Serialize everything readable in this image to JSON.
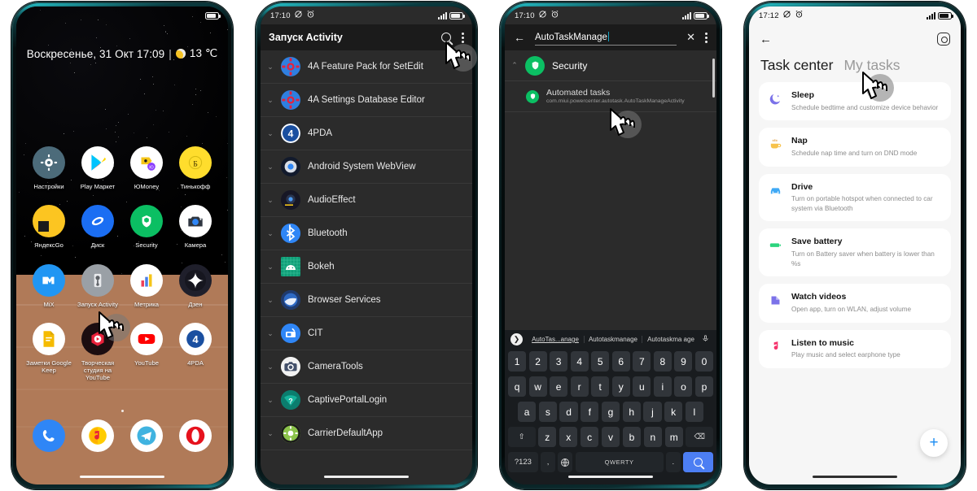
{
  "phones": [
    {
      "id": "home-screen",
      "statusbar": {
        "time": "",
        "icons": [
          "dnd-off-icon",
          "alarm-icon"
        ],
        "signal": "signal-icon",
        "battery": "battery-icon"
      },
      "widget": {
        "text": "Воскресенье, 31 Окт  17:09",
        "separator": "|",
        "weather_icon": "partly-sunny-icon",
        "temperature": "13 ℃"
      },
      "apps": [
        {
          "label": "Настройки",
          "icon": "gear-icon",
          "bg": "#4c6b7a",
          "glyph": "⚙"
        },
        {
          "label": "Play Маркет",
          "icon": "play-store-icon",
          "bg": "#ffffff",
          "glyph": "▶"
        },
        {
          "label": "ЮMoney",
          "icon": "yoomoney-icon",
          "bg": "#ffffff",
          "glyph": "💳"
        },
        {
          "label": "Тинькофф",
          "icon": "tinkoff-icon",
          "bg": "#ffdd2d",
          "glyph": "Т"
        },
        {
          "label": "ЯндексGo",
          "icon": "yandex-go-icon",
          "bg": "#fcc521",
          "glyph": ""
        },
        {
          "label": "Диск",
          "icon": "yandex-disk-icon",
          "bg": "#1b6ef3",
          "glyph": ""
        },
        {
          "label": "Security",
          "icon": "security-shield-icon",
          "bg": "#0bbf63",
          "glyph": "⬢"
        },
        {
          "label": "Камера",
          "icon": "camera-icon",
          "bg": "#ffffff",
          "glyph": "◉"
        },
        {
          "label": "MiX",
          "icon": "mixplorer-icon",
          "bg": "#2196f3",
          "glyph": ""
        },
        {
          "label": "Запуск Activity",
          "icon": "activity-launcher-icon",
          "bg": "#9aa0a6",
          "glyph": ""
        },
        {
          "label": "Метрика",
          "icon": "yandex-metrica-icon",
          "bg": "#ffffff",
          "glyph": ""
        },
        {
          "label": "Дзен",
          "icon": "zen-icon",
          "bg": "#1f1f2b",
          "glyph": "✦"
        },
        {
          "label": "Заметки Google Keep",
          "icon": "google-keep-icon",
          "bg": "#ffffff",
          "glyph": ""
        },
        {
          "label": "Творческая студия на YouTube",
          "icon": "youtube-studio-icon",
          "bg": "#1c0d10",
          "glyph": ""
        },
        {
          "label": "YouTube",
          "icon": "youtube-icon",
          "bg": "#ffffff",
          "glyph": ""
        },
        {
          "label": "4PDA",
          "icon": "4pda-icon",
          "bg": "#ffffff",
          "glyph": "4"
        }
      ],
      "dock": [
        {
          "label": "phone",
          "icon": "phone-icon",
          "bg": "#2f86f6",
          "glyph": "📞"
        },
        {
          "label": "yandex-music",
          "icon": "yandex-music-icon",
          "bg": "#ffffff",
          "glyph": ""
        },
        {
          "label": "telegram",
          "icon": "telegram-icon",
          "bg": "#ffffff",
          "glyph": ""
        },
        {
          "label": "opera",
          "icon": "opera-icon",
          "bg": "#ffffff",
          "glyph": ""
        }
      ],
      "page_indicator": "•"
    },
    {
      "id": "activity-launcher",
      "statusbar": {
        "time": "17:10",
        "icons": [
          "dnd-off-icon",
          "alarm-icon"
        ]
      },
      "appbar": {
        "title": "Запуск Activity",
        "search_icon": "search-icon",
        "overflow_icon": "more-vertical-icon"
      },
      "items": [
        {
          "name": "4A Feature Pack for SetEdit",
          "icon": "gear-red-blue-icon",
          "bg": "#2f7fe0",
          "glyph": "✹"
        },
        {
          "name": "4A Settings Database Editor",
          "icon": "gear-red-blue-icon",
          "bg": "#2f7fe0",
          "glyph": "✹"
        },
        {
          "name": "4PDA",
          "icon": "4pda-icon",
          "bg": "#1a4fa0",
          "glyph": "4"
        },
        {
          "name": "Android System WebView",
          "icon": "webview-icon",
          "bg": "#1a2438",
          "glyph": "◎"
        },
        {
          "name": "AudioEffect",
          "icon": "audioeffect-icon",
          "bg": "#1b1b28",
          "glyph": "◉"
        },
        {
          "name": "Bluetooth",
          "icon": "bluetooth-icon",
          "bg": "#2f86f6",
          "glyph": "✦"
        },
        {
          "name": "Bokeh",
          "icon": "bokeh-android-icon",
          "bg": "#0f9d77",
          "glyph": "⌬"
        },
        {
          "name": "Browser Services",
          "icon": "browser-services-icon",
          "bg": "#2a4a8f",
          "glyph": "◑"
        },
        {
          "name": "CIT",
          "icon": "cit-icon",
          "bg": "#2f86f6",
          "glyph": "▣"
        },
        {
          "name": "CameraTools",
          "icon": "camera-tools-icon",
          "bg": "#f2f2f2",
          "glyph": "◉"
        },
        {
          "name": "CaptivePortalLogin",
          "icon": "captive-portal-icon",
          "bg": "#14897a",
          "glyph": "?"
        },
        {
          "name": "CarrierDefaultApp",
          "icon": "carrier-default-icon",
          "bg": "#8bc34a",
          "glyph": "⚙"
        }
      ]
    },
    {
      "id": "activity-search",
      "statusbar": {
        "time": "17:10",
        "icons": [
          "dnd-off-icon",
          "alarm-icon"
        ]
      },
      "appbar": {
        "back_icon": "back-arrow-icon",
        "query": "AutoTaskManage",
        "clear_icon": "close-icon",
        "overflow_icon": "more-vertical-icon"
      },
      "group": {
        "name": "Security",
        "icon": "security-shield-icon",
        "collapse_icon": "chevron-up-icon"
      },
      "result": {
        "title": "Automated tasks",
        "component": "com.miui.powercenter.autotask.AutoTaskManageActivity",
        "icon": "security-shield-icon"
      },
      "keyboard": {
        "suggestions": [
          "AutoTas...anage",
          "Autotaskmanage",
          "Autotaskma age"
        ],
        "expand_icon": "chevron-right-icon",
        "mic_icon": "microphone-icon",
        "row_numbers": [
          "1",
          "2",
          "3",
          "4",
          "5",
          "6",
          "7",
          "8",
          "9",
          "0"
        ],
        "row_top": [
          "q",
          "w",
          "e",
          "r",
          "t",
          "y",
          "u",
          "i",
          "o",
          "p"
        ],
        "row_mid": [
          "a",
          "s",
          "d",
          "f",
          "g",
          "h",
          "j",
          "k",
          "l"
        ],
        "row_bot": [
          "z",
          "x",
          "c",
          "v",
          "b",
          "n",
          "m"
        ],
        "shift_label": "⇧",
        "backspace_label": "⌫",
        "symbols_label": "?123",
        "comma_label": ",",
        "globe_label": "🌐",
        "space_label": "QWERTY",
        "period_label": ".",
        "enter_icon": "search-icon"
      }
    },
    {
      "id": "task-center",
      "statusbar": {
        "time": "17:12",
        "icons": [
          "dnd-off-icon",
          "alarm-icon"
        ]
      },
      "appbar": {
        "back_icon": "back-arrow-icon",
        "settings_icon": "gear-icon"
      },
      "tabs": [
        {
          "label": "Task center",
          "active": true
        },
        {
          "label": "My tasks",
          "active": false
        }
      ],
      "cards": [
        {
          "title": "Sleep",
          "subtitle": "Schedule bedtime and customize device behavior",
          "icon": "moon-icon",
          "color": "#7b72e9",
          "glyph": "☾"
        },
        {
          "title": "Nap",
          "subtitle": "Schedule nap time and turn on DND mode",
          "icon": "cup-icon",
          "color": "#f7c24b",
          "glyph": "☕"
        },
        {
          "title": "Drive",
          "subtitle": "Turn on portable hotspot when connected to car system via Bluetooth",
          "icon": "car-icon",
          "color": "#3fa9f5",
          "glyph": "🚗"
        },
        {
          "title": "Save battery",
          "subtitle": "Turn on Battery saver when battery is lower than %s",
          "icon": "battery-icon",
          "color": "#2bd47d",
          "glyph": "▬"
        },
        {
          "title": "Watch videos",
          "subtitle": "Open app, turn on WLAN, adjust volume",
          "icon": "video-icon",
          "color": "#7b72e9",
          "glyph": "▶"
        },
        {
          "title": "Listen to music",
          "subtitle": "Play music and select earphone type",
          "icon": "music-note-icon",
          "color": "#f5326b",
          "glyph": "♪"
        }
      ],
      "fab": {
        "label": "+",
        "icon": "plus-icon",
        "color": "#1a8cf2"
      }
    }
  ]
}
